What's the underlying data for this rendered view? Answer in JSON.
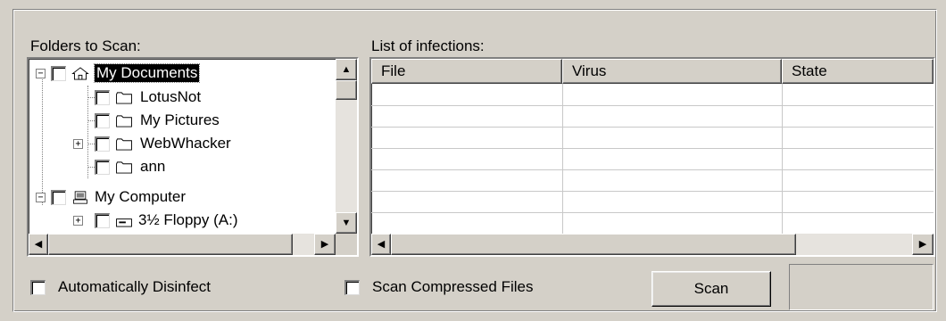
{
  "folders": {
    "label": "Folders to Scan:",
    "items": [
      {
        "label": "My Documents",
        "icon": "home-folder-icon",
        "expander": "−",
        "selected": true
      },
      {
        "label": "LotusNot",
        "icon": "folder-icon"
      },
      {
        "label": "My Pictures",
        "icon": "folder-icon"
      },
      {
        "label": "WebWhacker",
        "icon": "folder-icon",
        "expander": "+"
      },
      {
        "label": "ann",
        "icon": "folder-icon"
      },
      {
        "label": "My Computer",
        "icon": "computer-icon",
        "expander": "−"
      },
      {
        "label": "3½ Floppy (A:)",
        "icon": "floppy-drive-icon",
        "expander": "+"
      }
    ]
  },
  "infections": {
    "label": "List of infections:",
    "columns": [
      "File",
      "Virus",
      "State"
    ],
    "rows": []
  },
  "options": {
    "auto_disinfect": "Automatically Disinfect",
    "scan_compressed": "Scan Compressed Files"
  },
  "actions": {
    "scan": "Scan"
  },
  "colors": {
    "face": "#d4d0c8",
    "selection": "#000000"
  }
}
